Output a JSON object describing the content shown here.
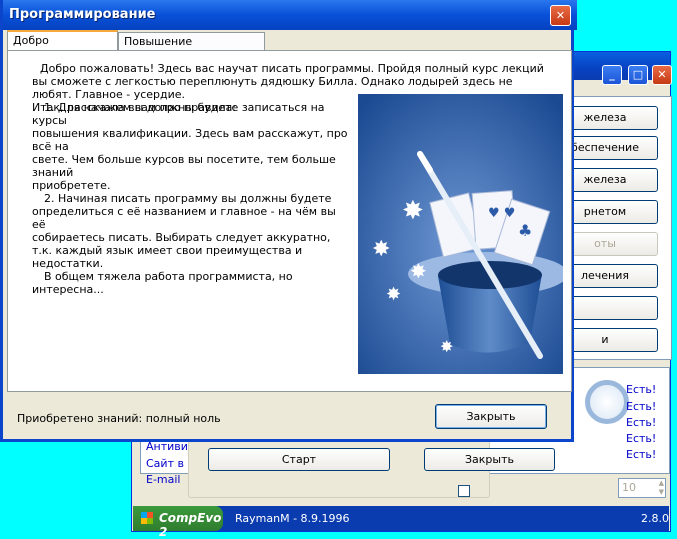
{
  "front": {
    "title": "Программирование",
    "close_glyph": "✕",
    "tabs": [
      {
        "label": "Добро пожаловать!"
      },
      {
        "label": "Повышение квалификации"
      }
    ],
    "paragraphs": [
      "Добро пожаловать! Здесь вас научат писать программы. Пройдя полный курс лекций вы сможете с легкостью переплюнуть дядюшку Билла. Однако лодырей здесь не любят. Главное - усердие.",
      "Итак, расскажем вам про правила:",
      "1. Для начала вы должны будете записаться на курсы",
      "повышения квалификации. Здесь вам расскажут, про всё на",
      "свете. Чем больше курсов вы посетите, тем больше знаний",
      "приобретете.",
      "2. Начиная писать программу вы должны будете",
      "определиться с её названием и главное - на чём вы её",
      "собираетесь писать. Выбирать следует аккуратно,",
      "т.к. каждый язык имеет свои преимущества и недостатки.",
      "В общем тяжела работа программиста, но интересна..."
    ],
    "status_text": "Приобретено знаний: полный ноль",
    "close_button": "Закрыть"
  },
  "back": {
    "title_buttons": [
      "_",
      "□",
      "✕"
    ],
    "menu_buttons": [
      {
        "label": "железа",
        "enabled": true
      },
      {
        "label": "беспечение",
        "enabled": true
      },
      {
        "label": "железа",
        "enabled": true
      },
      {
        "label": "рнетом",
        "enabled": true
      },
      {
        "label": "оты",
        "enabled": false
      },
      {
        "label": "лечения",
        "enabled": true
      },
      {
        "label": "",
        "enabled": true
      },
      {
        "label": "и",
        "enabled": true
      }
    ],
    "links": [
      "Есть!",
      "Есть!",
      "Есть!",
      "Есть!",
      "Есть!"
    ],
    "left_items": [
      "Антивир",
      "Сайт в и",
      "E-mail"
    ],
    "start_button": "Старт",
    "close_button": "Закрыть",
    "spinner_value": "10",
    "status_app": "CompEvo 2",
    "status_author": "RaymanM - 8.9.1996",
    "status_version": "2.8.0"
  },
  "colors": {
    "titlebar": "#0850d8",
    "art_bg": "#2a5ea8",
    "link": "#0000cc"
  }
}
